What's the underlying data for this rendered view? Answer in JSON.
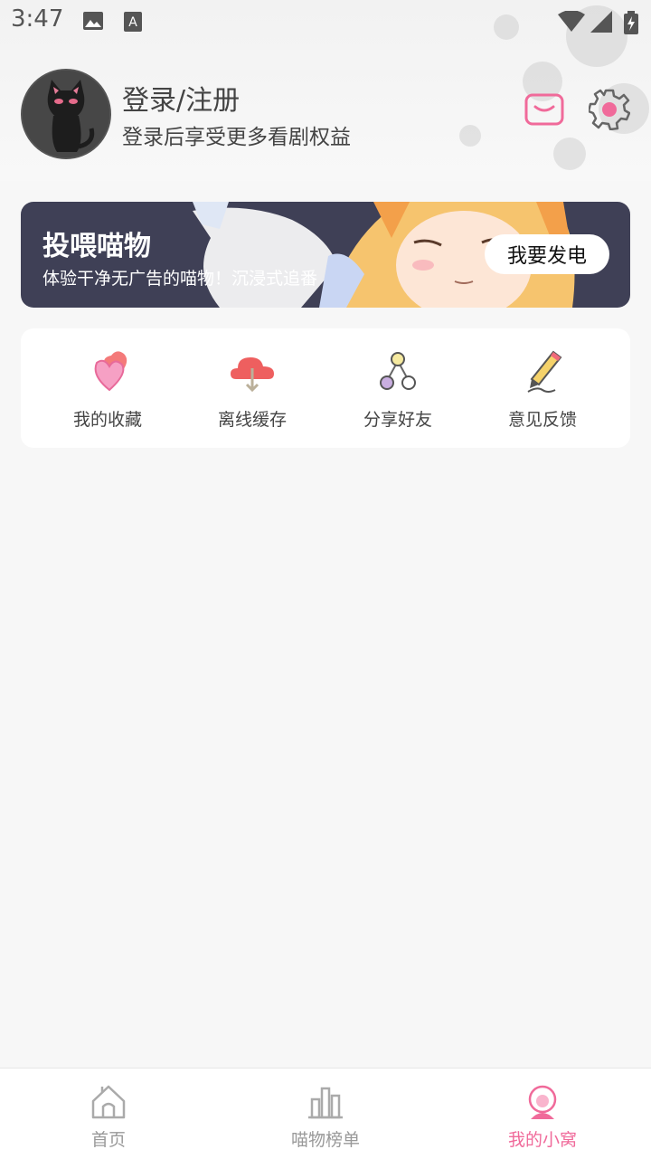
{
  "status_bar": {
    "time": "3:47"
  },
  "header": {
    "login_title": "登录/注册",
    "login_subtitle": "登录后享受更多看剧权益"
  },
  "banner": {
    "title": "投喂喵物",
    "subtitle": "体验干净无广告的喵物！沉浸式追番",
    "button_label": "我要发电"
  },
  "quick_actions": [
    {
      "label": "我的收藏",
      "icon": "hearts-icon"
    },
    {
      "label": "离线缓存",
      "icon": "cloud-download-icon"
    },
    {
      "label": "分享好友",
      "icon": "share-icon"
    },
    {
      "label": "意见反馈",
      "icon": "pencil-icon"
    }
  ],
  "bottom_nav": [
    {
      "label": "首页",
      "icon": "home-icon"
    },
    {
      "label": "喵物榜单",
      "icon": "chart-icon"
    },
    {
      "label": "我的小窝",
      "icon": "profile-icon",
      "active": true
    }
  ],
  "colors": {
    "accent": "#f06a9a",
    "banner_bg": "#3f4056",
    "page_bg": "#f7f7f7"
  }
}
